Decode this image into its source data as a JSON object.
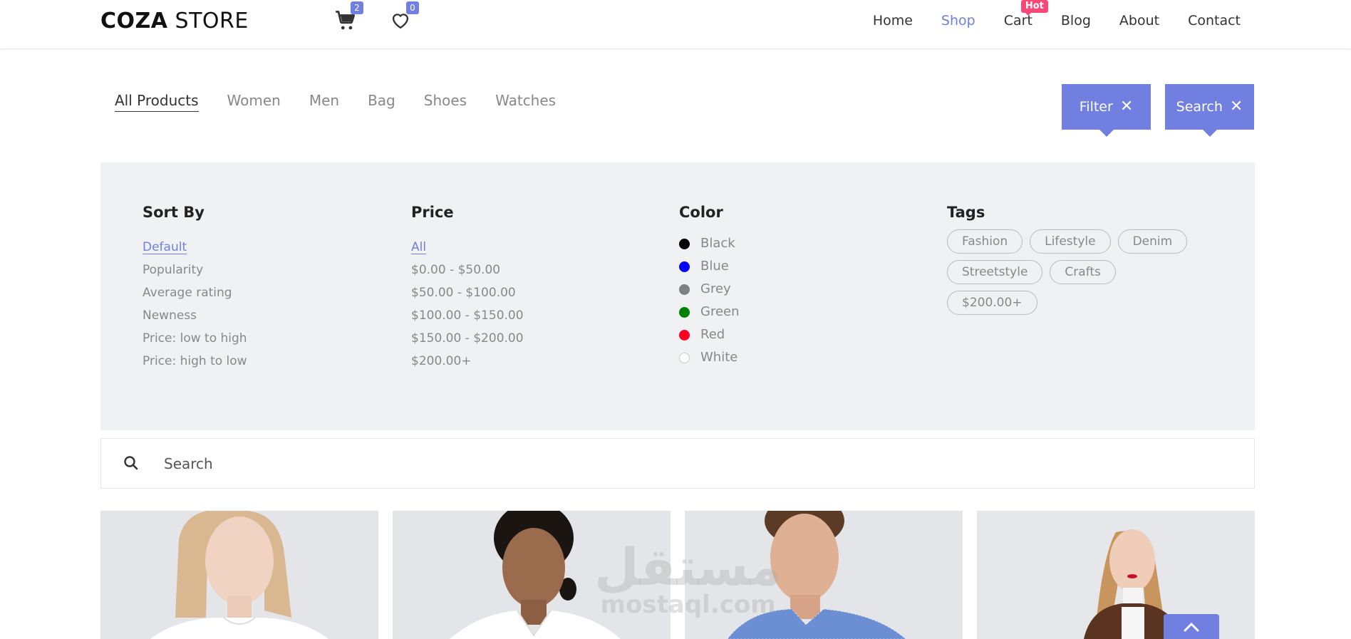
{
  "header": {
    "logo_bold": "COZA",
    "logo_light": "STORE",
    "cart_count": "2",
    "wishlist_count": "0",
    "nav": [
      {
        "label": "Home"
      },
      {
        "label": "Shop"
      },
      {
        "label": "Cart"
      },
      {
        "label": "Blog"
      },
      {
        "label": "About"
      },
      {
        "label": "Contact"
      }
    ],
    "active_nav": "Shop",
    "hot_badge": "Hot"
  },
  "categories": [
    "All Products",
    "Women",
    "Men",
    "Bag",
    "Shoes",
    "Watches"
  ],
  "active_category": "All Products",
  "toolbar": {
    "filter_label": "Filter",
    "search_label": "Search"
  },
  "filter_panel": {
    "sort": {
      "title": "Sort By",
      "options": [
        "Default",
        "Popularity",
        "Average rating",
        "Newness",
        "Price: low to high",
        "Price: high to low"
      ],
      "selected": "Default"
    },
    "price": {
      "title": "Price",
      "options": [
        "All",
        "$0.00 - $50.00",
        "$50.00 - $100.00",
        "$100.00 - $150.00",
        "$150.00 - $200.00",
        "$200.00+"
      ],
      "selected": "All"
    },
    "color": {
      "title": "Color",
      "options": [
        {
          "label": "Black",
          "hex": "#000000"
        },
        {
          "label": "Blue",
          "hex": "#0000ff"
        },
        {
          "label": "Grey",
          "hex": "#808080"
        },
        {
          "label": "Green",
          "hex": "#008000"
        },
        {
          "label": "Red",
          "hex": "#ff0022"
        },
        {
          "label": "White",
          "hex": "#ffffff"
        }
      ]
    },
    "tags": {
      "title": "Tags",
      "items": [
        "Fashion",
        "Lifestyle",
        "Denim",
        "Streetstyle",
        "Crafts",
        "$200.00+"
      ]
    }
  },
  "search": {
    "placeholder": "Search"
  },
  "products": [
    {
      "image": "product-woman-blonde-white-tee"
    },
    {
      "image": "product-woman-white-shirt"
    },
    {
      "image": "product-man-blue-check-shirt"
    },
    {
      "image": "product-woman-brown-fur-jacket"
    }
  ],
  "watermark": {
    "arabic": "مستقل",
    "latin": "mostaql.com"
  },
  "colors": {
    "accent": "#717fe0",
    "hot": "#f74877",
    "panel_bg": "#f0f1f2"
  },
  "icons": [
    "cart-icon",
    "heart-icon",
    "close-icon",
    "search-icon",
    "chevron-up-icon"
  ]
}
